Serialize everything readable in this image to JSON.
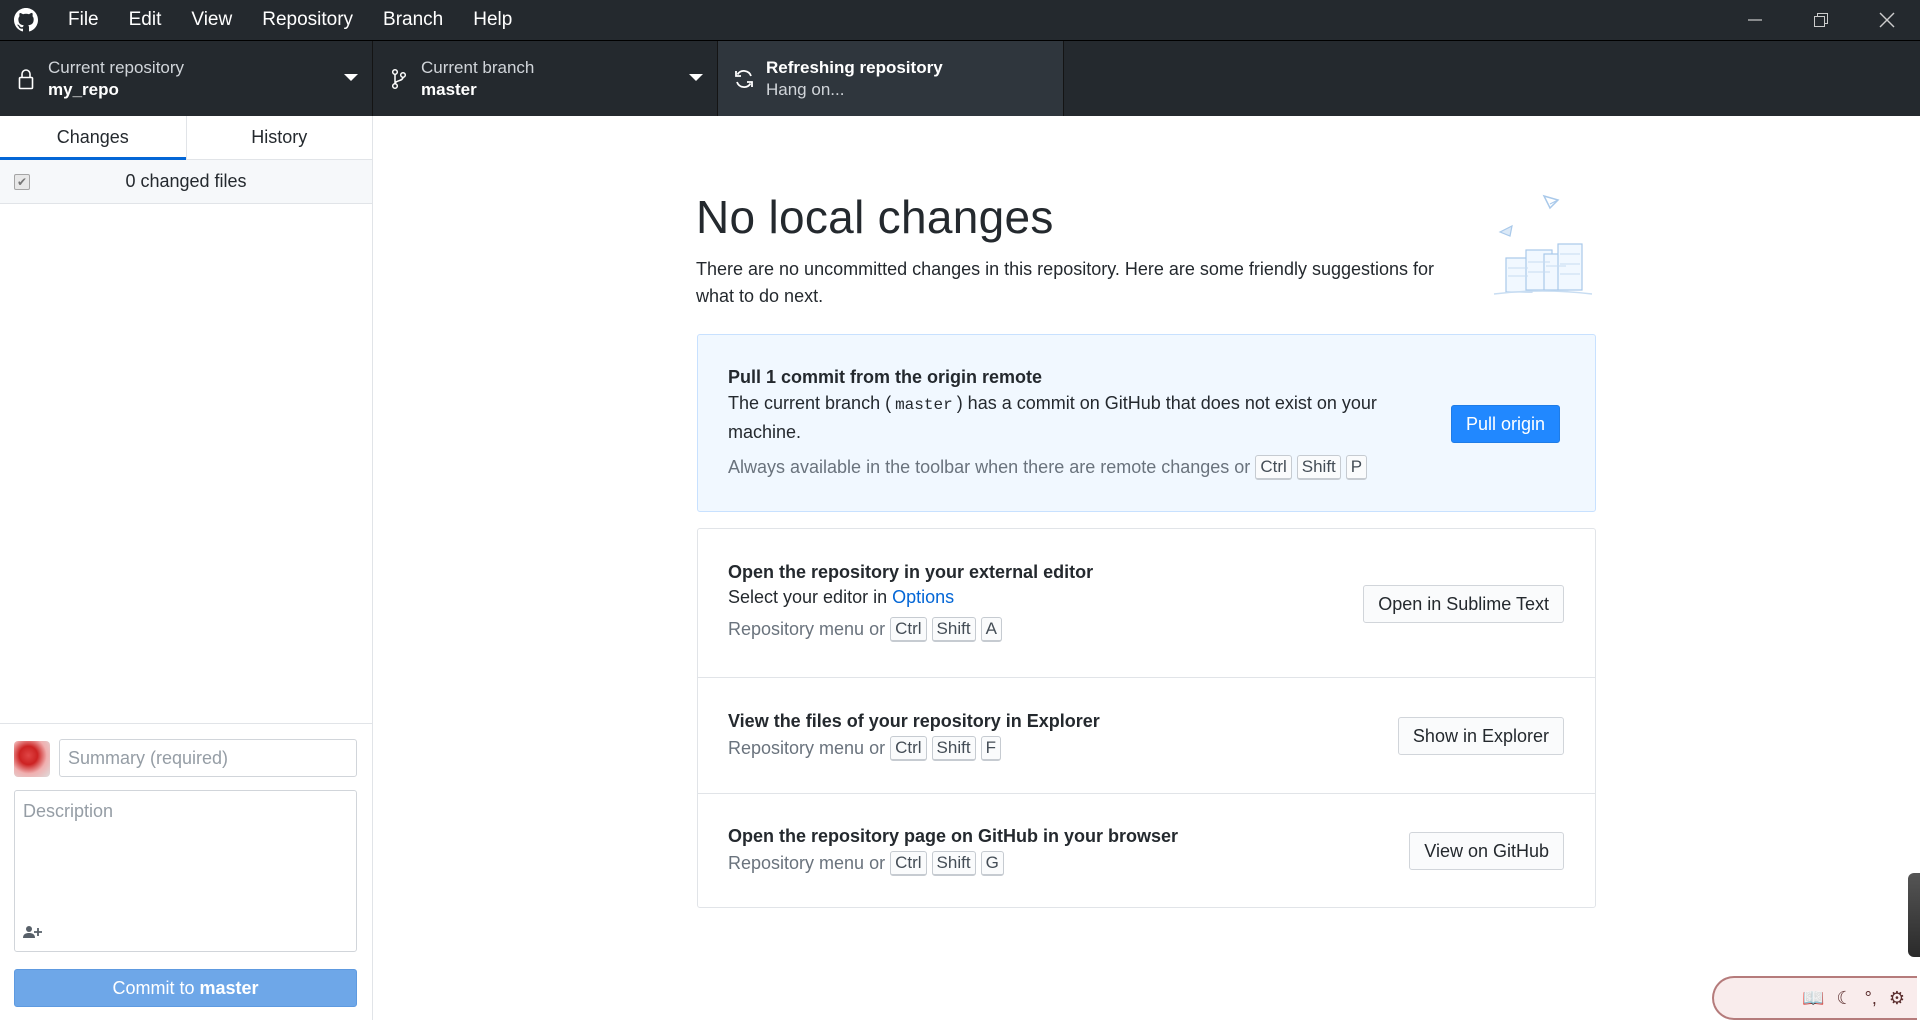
{
  "menu": {
    "items": [
      "File",
      "Edit",
      "View",
      "Repository",
      "Branch",
      "Help"
    ]
  },
  "toolbar": {
    "repo_label": "Current repository",
    "repo_value": "my_repo",
    "branch_label": "Current branch",
    "branch_value": "master",
    "refresh_title": "Refreshing repository",
    "refresh_sub": "Hang on..."
  },
  "sidebar": {
    "tabs": [
      "Changes",
      "History"
    ],
    "changed_files": "0 changed files",
    "summary_placeholder": "Summary (required)",
    "description_placeholder": "Description",
    "commit_prefix": "Commit to",
    "commit_branch": "master"
  },
  "main": {
    "title": "No local changes",
    "subtitle": "There are no uncommitted changes in this repository. Here are some friendly suggestions for what to do next.",
    "pull": {
      "title": "Pull 1 commit from the origin remote",
      "desc_before": "The current branch (",
      "desc_code": "master",
      "desc_after": ") has a commit on GitHub that does not exist on your machine.",
      "hint": "Always available in the toolbar when there are remote changes or",
      "keys": [
        "Ctrl",
        "Shift",
        "P"
      ],
      "button": "Pull origin"
    },
    "editor": {
      "title": "Open the repository in your external editor",
      "desc_before": "Select your editor in",
      "desc_link": "Options",
      "hint": "Repository menu or",
      "keys": [
        "Ctrl",
        "Shift",
        "A"
      ],
      "button": "Open in Sublime Text"
    },
    "explorer": {
      "title": "View the files of your repository in Explorer",
      "hint": "Repository menu or",
      "keys": [
        "Ctrl",
        "Shift",
        "F"
      ],
      "button": "Show in Explorer"
    },
    "github": {
      "title": "Open the repository page on GitHub in your browser",
      "hint": "Repository menu or",
      "keys": [
        "Ctrl",
        "Shift",
        "G"
      ],
      "button": "View on GitHub"
    }
  },
  "colors": {
    "titlebar": "#24292e",
    "accent": "#0366d6",
    "primary_button": "#2188ff",
    "commit_button_disabled": "#6ea7e8"
  }
}
